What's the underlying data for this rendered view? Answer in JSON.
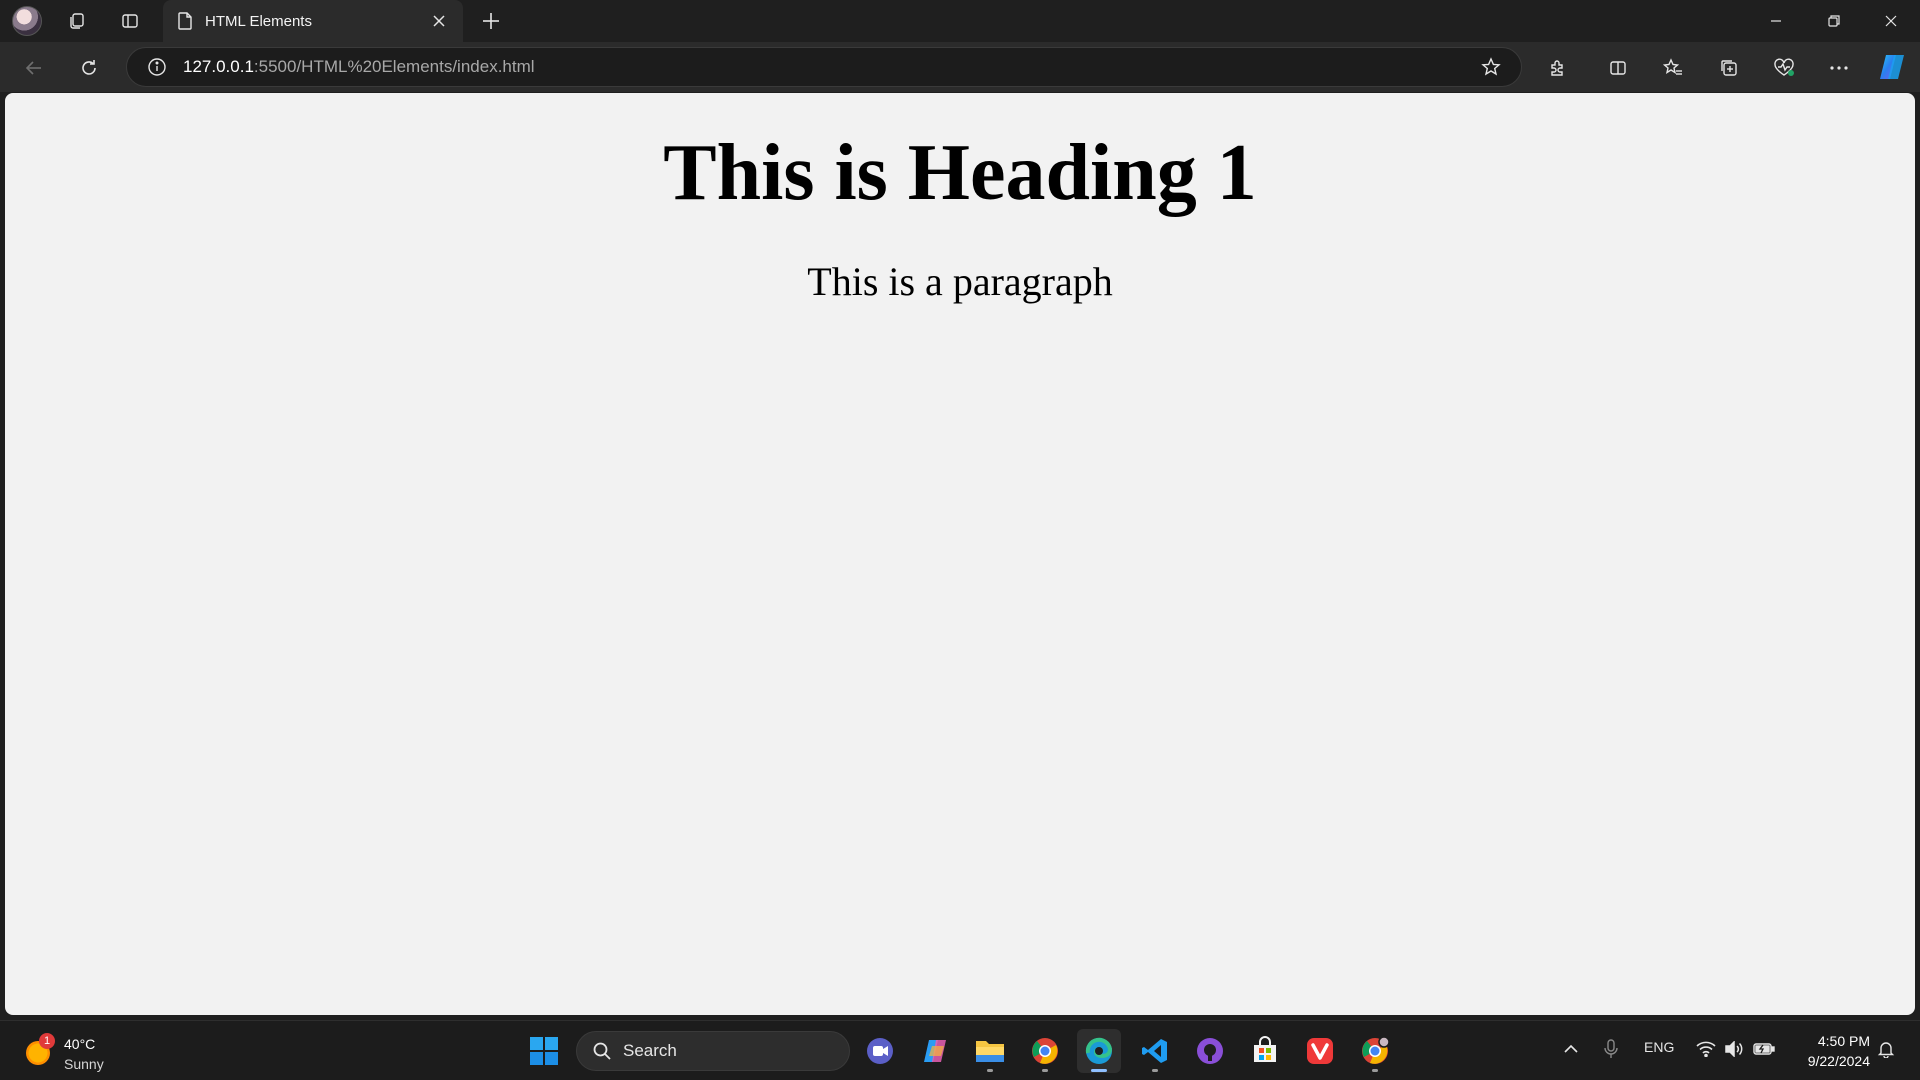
{
  "browser": {
    "tab": {
      "title": "HTML Elements"
    },
    "address": {
      "host": "127.0.0.1",
      "path": ":5500/HTML%20Elements/index.html"
    }
  },
  "page": {
    "heading": "This is Heading 1",
    "paragraph": "This is a paragraph"
  },
  "taskbar": {
    "weather": {
      "temp": "40°C",
      "condition": "Sunny",
      "badge": "1"
    },
    "search_label": "Search",
    "language": "ENG",
    "time": "4:50 PM",
    "date": "9/22/2024"
  },
  "colors": {
    "page_bg": "#f2f2f2",
    "chrome_bg": "#1f1f1f",
    "toolbar_bg": "#2b2b2b",
    "accent": "#0078d4"
  }
}
